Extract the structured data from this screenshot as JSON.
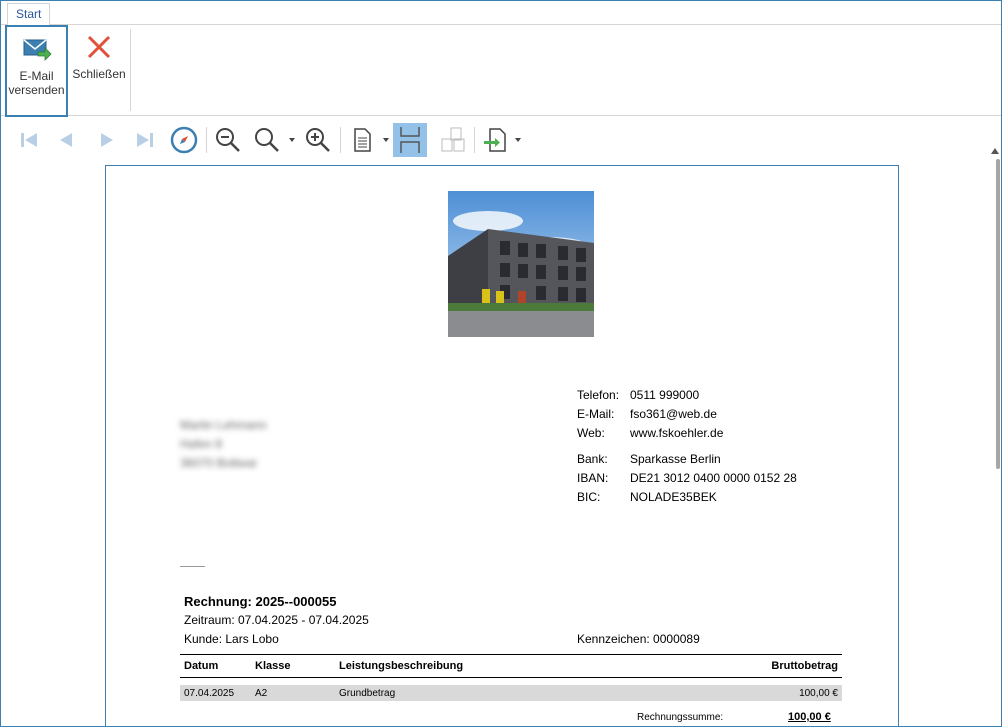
{
  "tabs": [
    {
      "label": "Start"
    }
  ],
  "ribbon": {
    "email_line1": "E-Mail",
    "email_line2": "versenden",
    "close_label": "Schließen"
  },
  "toolbar": {
    "icons": [
      "first-page-icon",
      "previous-page-icon",
      "next-page-icon",
      "last-page-icon",
      "navigation-compass-icon",
      "zoom-out-icon",
      "zoom-icon",
      "zoom-in-icon",
      "page-layout-icon",
      "continuous-page-icon",
      "multiple-pages-icon",
      "export-icon"
    ],
    "accent": "#3c7fb1"
  },
  "document": {
    "contact": {
      "phone_label": "Telefon:",
      "phone": "0511 999000",
      "email_label": "E-Mail:",
      "email": "fso361@web.de",
      "web_label": "Web:",
      "web": "www.fskoehler.de",
      "bank_label": "Bank:",
      "bank": "Sparkasse Berlin",
      "iban_label": "IBAN:",
      "iban": "DE21 3012 0400 0000 0152 28",
      "bic_label": "BIC:",
      "bic": "NOLADE35BEK"
    },
    "recipient": {
      "line1": "Martin Lehmann",
      "line2": "Hafen 8",
      "line3": "36070 Bottwar"
    },
    "invoice_title": "Rechnung: 2025--000055",
    "period": "Zeitraum: 07.04.2025 - 07.04.2025",
    "customer": "Kunde: Lars Lobo",
    "plate": "Kennzeichen: 0000089",
    "table": {
      "headers": [
        "Datum",
        "Klasse",
        "Leistungsbeschreibung",
        "Bruttobetrag"
      ],
      "rows": [
        [
          "07.04.2025",
          "A2",
          "Grundbetrag",
          "100,00 €"
        ]
      ]
    },
    "total_label": "Rechnungssumme:",
    "total_value": "100,00 €"
  }
}
